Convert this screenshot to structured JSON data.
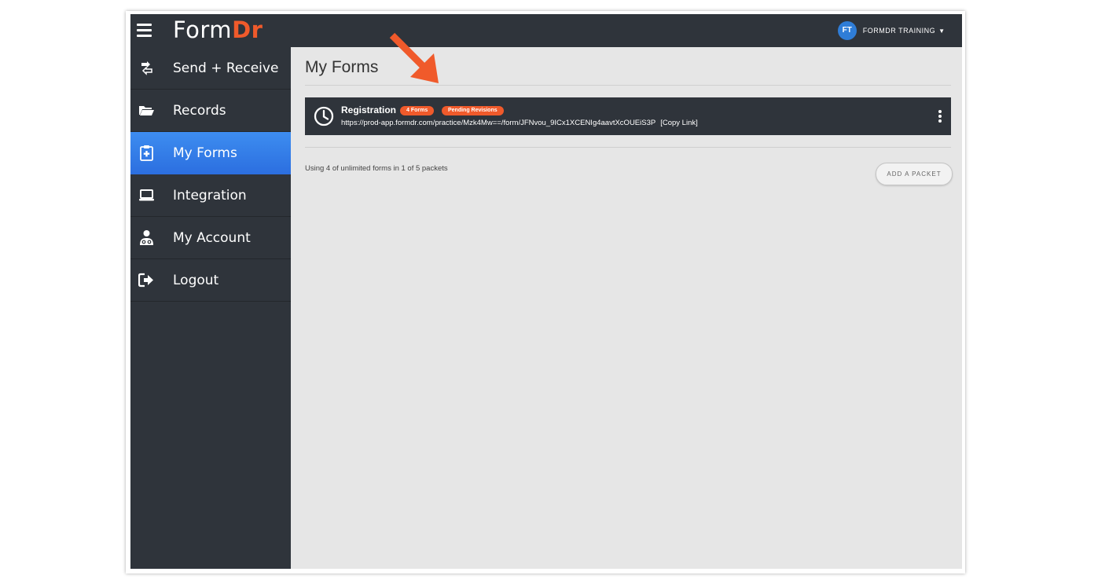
{
  "header": {
    "logo_part1": "Form",
    "logo_part2": "Dr",
    "user_initials": "FT",
    "user_name": "FORMDR TRAINING",
    "user_caret": "▼"
  },
  "sidebar": {
    "items": [
      {
        "label": "Send + Receive",
        "icon": "send-receive-icon",
        "active": false
      },
      {
        "label": "Records",
        "icon": "folder-icon",
        "active": false
      },
      {
        "label": "My Forms",
        "icon": "clipboard-icon",
        "active": true
      },
      {
        "label": "Integration",
        "icon": "laptop-icon",
        "active": false
      },
      {
        "label": "My Account",
        "icon": "user-doctor-icon",
        "active": false
      },
      {
        "label": "Logout",
        "icon": "logout-icon",
        "active": false
      }
    ]
  },
  "main": {
    "title": "My Forms",
    "packet": {
      "name": "Registration",
      "badge_forms": "4 Forms",
      "badge_status": "Pending Revisions",
      "url": "https://prod-app.formdr.com/practice/Mzk4Mw==/form/JFNvou_9ICx1XCENIg4aavtXcOUEiS3P",
      "copy_link": "[Copy Link]"
    },
    "usage_text": "Using 4 of unlimited forms in 1 of 5 packets",
    "add_packet_label": "ADD A PACKET"
  },
  "colors": {
    "sidebar_bg": "#2f343b",
    "active_blue": "#3d8df0",
    "accent_orange": "#f05a2b",
    "content_bg": "#e6e6e6",
    "avatar_blue": "#2f7dd7"
  }
}
